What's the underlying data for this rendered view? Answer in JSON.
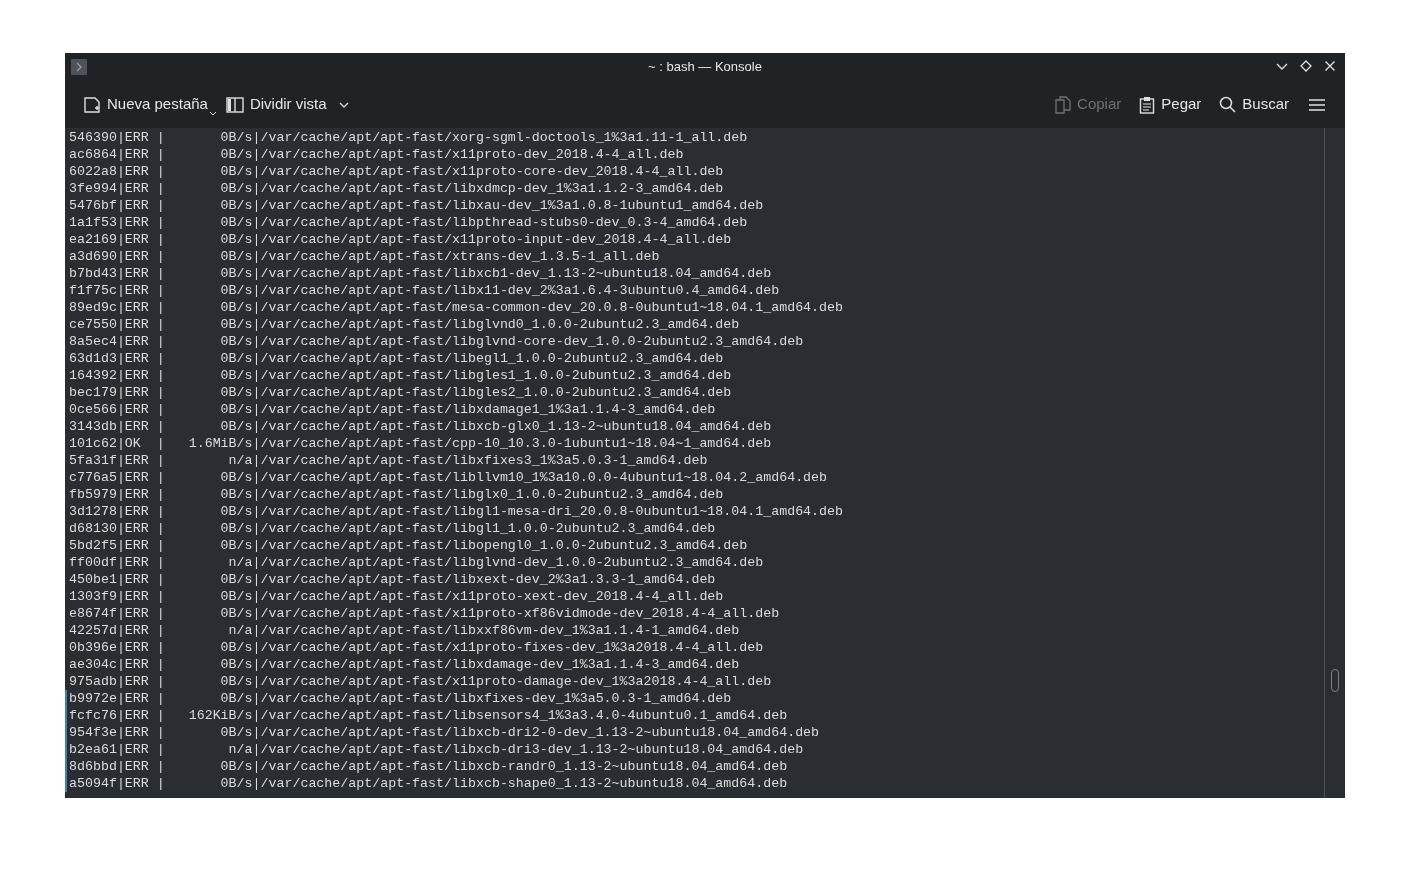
{
  "window": {
    "title": "~ : bash — Konsole"
  },
  "toolbar": {
    "left": [
      {
        "kind": "new-tab",
        "label": "Nueva pestaña",
        "disabled": false
      },
      {
        "kind": "split",
        "label": "Dividir vista",
        "disabled": false
      }
    ],
    "right": [
      {
        "kind": "copy",
        "label": "Copiar",
        "disabled": true
      },
      {
        "kind": "paste",
        "label": "Pegar",
        "disabled": false
      },
      {
        "kind": "search",
        "label": "Buscar",
        "disabled": false
      }
    ]
  },
  "terminal": {
    "lines": [
      {
        "text": "546390|ERR |       0B/s|/var/cache/apt/apt-fast/xorg-sgml-doctools_1%3a1.11-1_all.deb",
        "marked": false
      },
      {
        "text": "ac6864|ERR |       0B/s|/var/cache/apt/apt-fast/x11proto-dev_2018.4-4_all.deb",
        "marked": false
      },
      {
        "text": "6022a8|ERR |       0B/s|/var/cache/apt/apt-fast/x11proto-core-dev_2018.4-4_all.deb",
        "marked": false
      },
      {
        "text": "3fe994|ERR |       0B/s|/var/cache/apt/apt-fast/libxdmcp-dev_1%3a1.1.2-3_amd64.deb",
        "marked": false
      },
      {
        "text": "5476bf|ERR |       0B/s|/var/cache/apt/apt-fast/libxau-dev_1%3a1.0.8-1ubuntu1_amd64.deb",
        "marked": false
      },
      {
        "text": "1a1f53|ERR |       0B/s|/var/cache/apt/apt-fast/libpthread-stubs0-dev_0.3-4_amd64.deb",
        "marked": false
      },
      {
        "text": "ea2169|ERR |       0B/s|/var/cache/apt/apt-fast/x11proto-input-dev_2018.4-4_all.deb",
        "marked": false
      },
      {
        "text": "a3d690|ERR |       0B/s|/var/cache/apt/apt-fast/xtrans-dev_1.3.5-1_all.deb",
        "marked": false
      },
      {
        "text": "b7bd43|ERR |       0B/s|/var/cache/apt/apt-fast/libxcb1-dev_1.13-2~ubuntu18.04_amd64.deb",
        "marked": false
      },
      {
        "text": "f1f75c|ERR |       0B/s|/var/cache/apt/apt-fast/libx11-dev_2%3a1.6.4-3ubuntu0.4_amd64.deb",
        "marked": false
      },
      {
        "text": "89ed9c|ERR |       0B/s|/var/cache/apt/apt-fast/mesa-common-dev_20.0.8-0ubuntu1~18.04.1_amd64.deb",
        "marked": false
      },
      {
        "text": "ce7550|ERR |       0B/s|/var/cache/apt/apt-fast/libglvnd0_1.0.0-2ubuntu2.3_amd64.deb",
        "marked": false
      },
      {
        "text": "8a5ec4|ERR |       0B/s|/var/cache/apt/apt-fast/libglvnd-core-dev_1.0.0-2ubuntu2.3_amd64.deb",
        "marked": false
      },
      {
        "text": "63d1d3|ERR |       0B/s|/var/cache/apt/apt-fast/libegl1_1.0.0-2ubuntu2.3_amd64.deb",
        "marked": false
      },
      {
        "text": "164392|ERR |       0B/s|/var/cache/apt/apt-fast/libgles1_1.0.0-2ubuntu2.3_amd64.deb",
        "marked": false
      },
      {
        "text": "bec179|ERR |       0B/s|/var/cache/apt/apt-fast/libgles2_1.0.0-2ubuntu2.3_amd64.deb",
        "marked": false
      },
      {
        "text": "0ce566|ERR |       0B/s|/var/cache/apt/apt-fast/libxdamage1_1%3a1.1.4-3_amd64.deb",
        "marked": false
      },
      {
        "text": "3143db|ERR |       0B/s|/var/cache/apt/apt-fast/libxcb-glx0_1.13-2~ubuntu18.04_amd64.deb",
        "marked": false
      },
      {
        "text": "101c62|OK  |   1.6MiB/s|/var/cache/apt/apt-fast/cpp-10_10.3.0-1ubuntu1~18.04~1_amd64.deb",
        "marked": false
      },
      {
        "text": "5fa31f|ERR |        n/a|/var/cache/apt/apt-fast/libxfixes3_1%3a5.0.3-1_amd64.deb",
        "marked": false
      },
      {
        "text": "c776a5|ERR |       0B/s|/var/cache/apt/apt-fast/libllvm10_1%3a10.0.0-4ubuntu1~18.04.2_amd64.deb",
        "marked": false
      },
      {
        "text": "fb5979|ERR |       0B/s|/var/cache/apt/apt-fast/libglx0_1.0.0-2ubuntu2.3_amd64.deb",
        "marked": false
      },
      {
        "text": "3d1278|ERR |       0B/s|/var/cache/apt/apt-fast/libgl1-mesa-dri_20.0.8-0ubuntu1~18.04.1_amd64.deb",
        "marked": false
      },
      {
        "text": "d68130|ERR |       0B/s|/var/cache/apt/apt-fast/libgl1_1.0.0-2ubuntu2.3_amd64.deb",
        "marked": false
      },
      {
        "text": "5bd2f5|ERR |       0B/s|/var/cache/apt/apt-fast/libopengl0_1.0.0-2ubuntu2.3_amd64.deb",
        "marked": false
      },
      {
        "text": "ff00df|ERR |        n/a|/var/cache/apt/apt-fast/libglvnd-dev_1.0.0-2ubuntu2.3_amd64.deb",
        "marked": false
      },
      {
        "text": "450be1|ERR |       0B/s|/var/cache/apt/apt-fast/libxext-dev_2%3a1.3.3-1_amd64.deb",
        "marked": false
      },
      {
        "text": "1303f9|ERR |       0B/s|/var/cache/apt/apt-fast/x11proto-xext-dev_2018.4-4_all.deb",
        "marked": false
      },
      {
        "text": "e8674f|ERR |       0B/s|/var/cache/apt/apt-fast/x11proto-xf86vidmode-dev_2018.4-4_all.deb",
        "marked": false
      },
      {
        "text": "42257d|ERR |        n/a|/var/cache/apt/apt-fast/libxxf86vm-dev_1%3a1.1.4-1_amd64.deb",
        "marked": false
      },
      {
        "text": "0b396e|ERR |       0B/s|/var/cache/apt/apt-fast/x11proto-fixes-dev_1%3a2018.4-4_all.deb",
        "marked": false
      },
      {
        "text": "ae304c|ERR |       0B/s|/var/cache/apt/apt-fast/libxdamage-dev_1%3a1.1.4-3_amd64.deb",
        "marked": false
      },
      {
        "text": "975adb|ERR |       0B/s|/var/cache/apt/apt-fast/x11proto-damage-dev_1%3a2018.4-4_all.deb",
        "marked": false
      },
      {
        "text": "b9972e|ERR |       0B/s|/var/cache/apt/apt-fast/libxfixes-dev_1%3a5.0.3-1_amd64.deb",
        "marked": true
      },
      {
        "text": "fcfc76|ERR |   162KiB/s|/var/cache/apt/apt-fast/libsensors4_1%3a3.4.0-4ubuntu0.1_amd64.deb",
        "marked": true
      },
      {
        "text": "954f3e|ERR |       0B/s|/var/cache/apt/apt-fast/libxcb-dri2-0-dev_1.13-2~ubuntu18.04_amd64.deb",
        "marked": true
      },
      {
        "text": "b2ea61|ERR |        n/a|/var/cache/apt/apt-fast/libxcb-dri3-dev_1.13-2~ubuntu18.04_amd64.deb",
        "marked": true
      },
      {
        "text": "8d6bbd|ERR |       0B/s|/var/cache/apt/apt-fast/libxcb-randr0_1.13-2~ubuntu18.04_amd64.deb",
        "marked": true
      },
      {
        "text": "a5094f|ERR |       0B/s|/var/cache/apt/apt-fast/libxcb-shape0_1.13-2~ubuntu18.04_amd64.deb",
        "marked": true
      }
    ]
  }
}
